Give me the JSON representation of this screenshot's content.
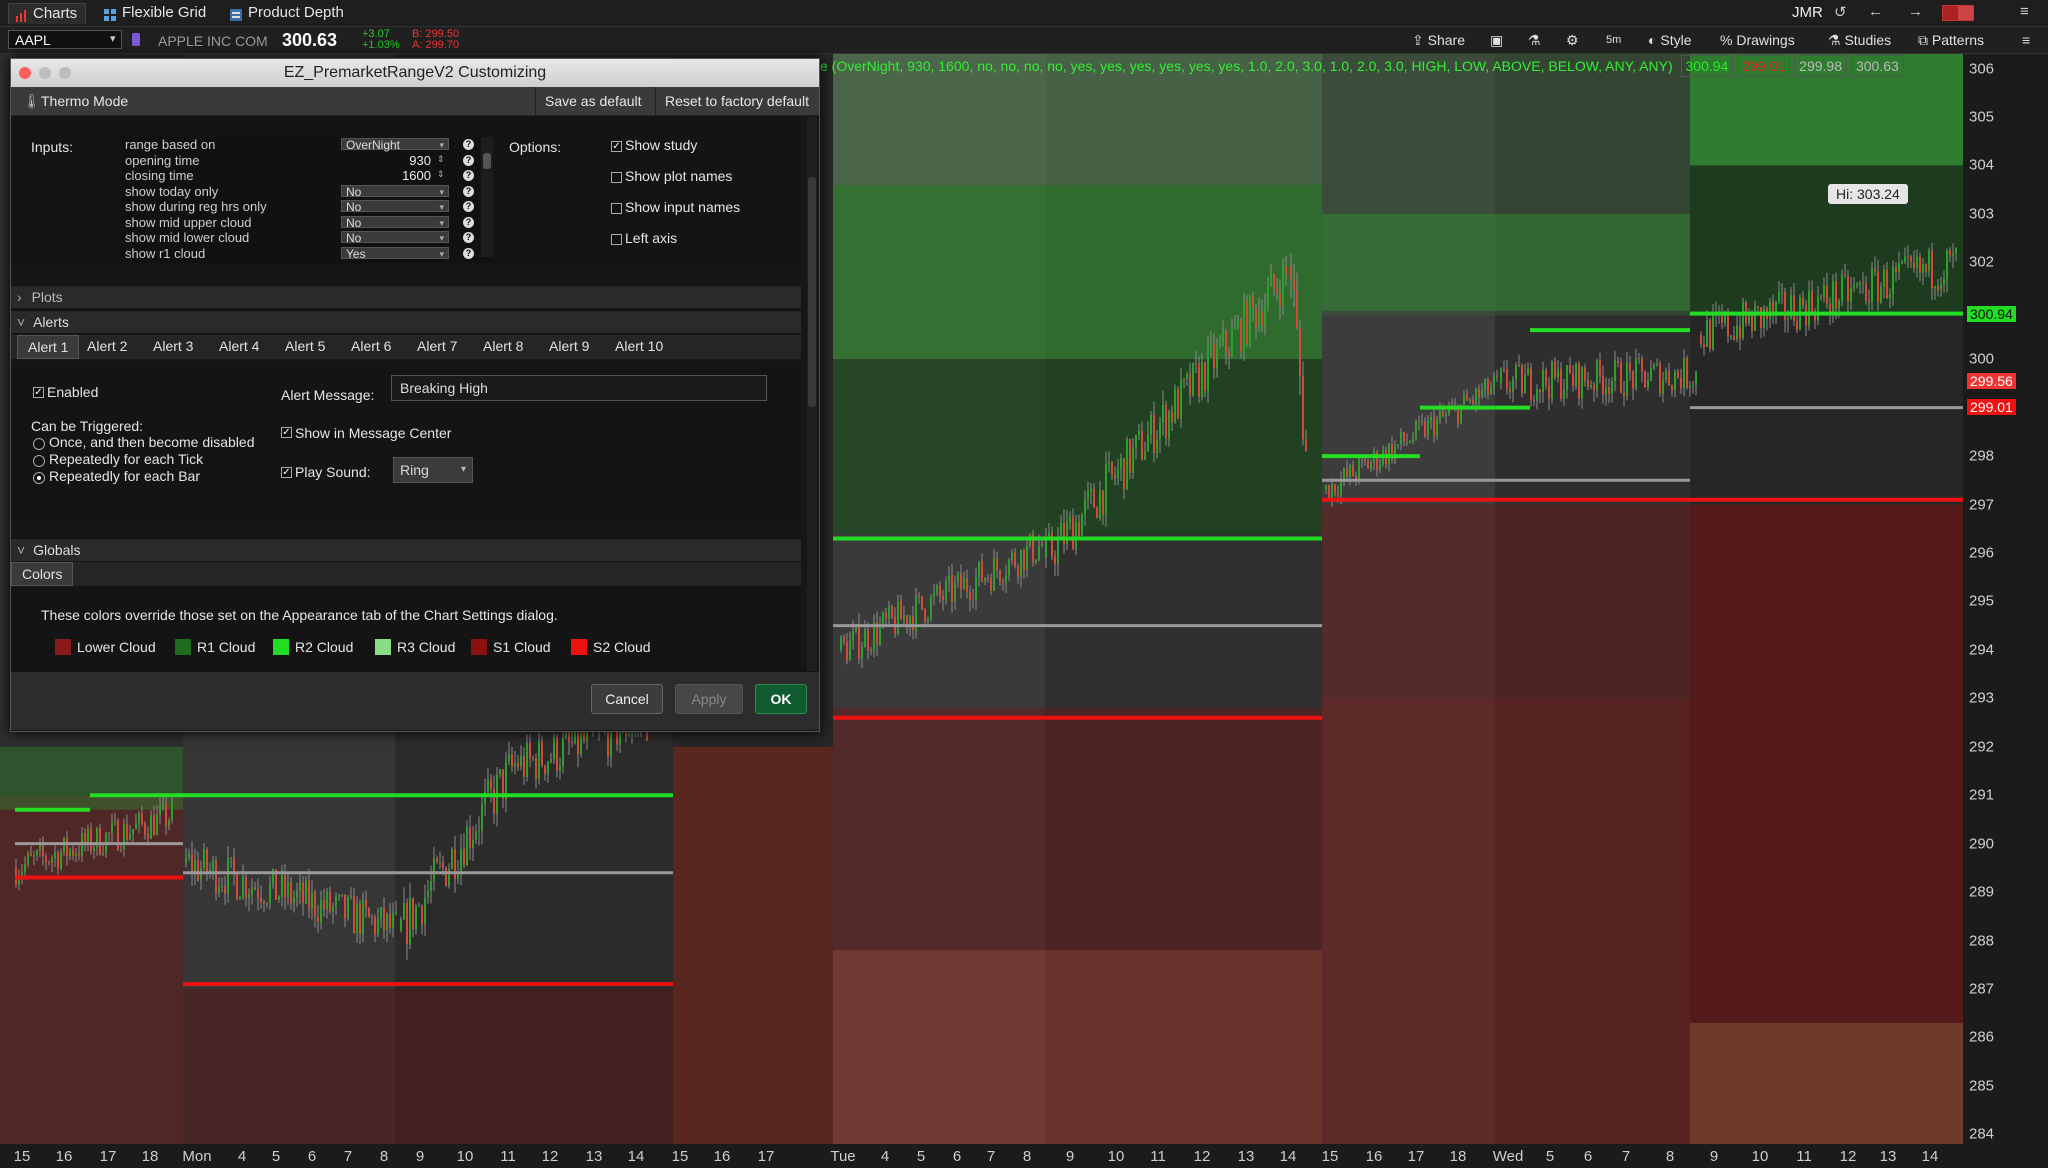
{
  "tabs": [
    {
      "label": "Charts",
      "active": true
    },
    {
      "label": "Flexible Grid",
      "active": false
    },
    {
      "label": "Product Depth",
      "active": false
    }
  ],
  "account": "JMR",
  "symbol": {
    "ticker": "AAPL",
    "name": "APPLE INC COM",
    "last": "300.63",
    "change": "+3.07",
    "change_pct": "+1.03%",
    "bid": "B: 299.50",
    "ask": "A: 299.70"
  },
  "toolbar": {
    "share": "Share",
    "timeframe": "5m",
    "style": "Style",
    "drawings": "Drawings",
    "studies": "Studies",
    "patterns": "Patterns"
  },
  "study_line": {
    "text": "e (OverNight, 930, 1600, no, no, no, no, yes, yes, yes, yes, yes, yes, 1.0, 2.0, 3.0, 1.0, 2.0, 3.0, HIGH, LOW, ABOVE, BELOW, ANY, ANY)",
    "values": [
      "300.94",
      "299.01",
      "299.98",
      "300.63"
    ]
  },
  "dialog": {
    "title": "EZ_PremarketRangeV2 Customizing",
    "thermo_mode": "Thermo Mode",
    "save_default": "Save as default",
    "reset_default": "Reset to factory default",
    "inputs_label": "Inputs:",
    "inputs": [
      {
        "name": "range based on",
        "value": "OverNight",
        "kind": "dropdown"
      },
      {
        "name": "opening time",
        "value": "930",
        "kind": "number"
      },
      {
        "name": "closing time",
        "value": "1600",
        "kind": "number"
      },
      {
        "name": "show today only",
        "value": "No",
        "kind": "dropdown"
      },
      {
        "name": "show during reg hrs only",
        "value": "No",
        "kind": "dropdown"
      },
      {
        "name": "show mid upper cloud",
        "value": "No",
        "kind": "dropdown"
      },
      {
        "name": "show mid lower cloud",
        "value": "No",
        "kind": "dropdown"
      },
      {
        "name": "show r1 cloud",
        "value": "Yes",
        "kind": "dropdown"
      }
    ],
    "options_label": "Options:",
    "options": [
      {
        "label": "Show study",
        "checked": true
      },
      {
        "label": "Show plot names",
        "checked": false
      },
      {
        "label": "Show input names",
        "checked": false
      },
      {
        "label": "Left axis",
        "checked": false
      }
    ],
    "plots_label": "Plots",
    "alerts_label": "Alerts",
    "alert_tabs": [
      "Alert 1",
      "Alert 2",
      "Alert 3",
      "Alert 4",
      "Alert 5",
      "Alert 6",
      "Alert 7",
      "Alert 8",
      "Alert 9",
      "Alert 10"
    ],
    "enabled_label": "Enabled",
    "alert_message_label": "Alert Message:",
    "alert_message_value": "Breaking High",
    "can_be_triggered": "Can be Triggered:",
    "trigger_options": [
      {
        "label": "Once, and then become disabled",
        "selected": false
      },
      {
        "label": "Repeatedly for each Tick",
        "selected": false
      },
      {
        "label": "Repeatedly for each Bar",
        "selected": true
      }
    ],
    "show_in_message_center": "Show in Message Center",
    "play_sound": "Play Sound:",
    "sound_value": "Ring",
    "globals_label": "Globals",
    "colors_tab": "Colors",
    "colors_note": "These colors override those set on the Appearance tab of the Chart Settings dialog.",
    "colors": [
      {
        "label": "Lower Cloud",
        "color": "#8b1a1a"
      },
      {
        "label": "R1 Cloud",
        "color": "#1f6b1f"
      },
      {
        "label": "R2 Cloud",
        "color": "#22dd22"
      },
      {
        "label": "R3 Cloud",
        "color": "#88dd88"
      },
      {
        "label": "S1 Cloud",
        "color": "#8b1010"
      },
      {
        "label": "S2 Cloud",
        "color": "#ee1111"
      }
    ],
    "cancel": "Cancel",
    "apply": "Apply",
    "ok": "OK"
  },
  "chart_data": {
    "type": "candlestick",
    "symbol": "AAPL",
    "interval": "5m",
    "y_ticks": [
      306,
      305,
      304,
      303,
      302,
      301,
      300,
      299,
      298,
      297,
      296,
      295,
      294,
      293,
      292,
      291,
      290,
      289,
      288,
      287,
      286,
      285,
      284
    ],
    "y_tick_labels": [
      "306",
      "305",
      "304",
      "303",
      "302",
      "",
      "300",
      "",
      "298",
      "297",
      "296",
      "295",
      "294",
      "293",
      "292",
      "291",
      "290",
      "289",
      "288",
      "287",
      "286",
      "285",
      "284"
    ],
    "ylim": [
      283.8,
      306.3
    ],
    "x_labels": [
      "15",
      "16",
      "17",
      "18",
      "Mon",
      "4",
      "5",
      "6",
      "7",
      "8",
      "9",
      "10",
      "11",
      "12",
      "13",
      "14",
      "15",
      "16",
      "17",
      "Tue",
      "4",
      "5",
      "6",
      "7",
      "8",
      "9",
      "10",
      "11",
      "12",
      "13",
      "14",
      "15",
      "16",
      "17",
      "18",
      "Wed",
      "5",
      "6",
      "7",
      "8",
      "9",
      "10",
      "11",
      "12",
      "13",
      "14"
    ],
    "price_badges": [
      {
        "value": "300.94",
        "color": "#22dd22"
      },
      {
        "value": "299.56",
        "color": "#ee3333"
      },
      {
        "value": "299.01",
        "color": "#ee1111"
      }
    ],
    "annotation": "Hi: 303.24",
    "levels": {
      "breaking_high": 300.94,
      "breaking_low": 297.0
    }
  }
}
